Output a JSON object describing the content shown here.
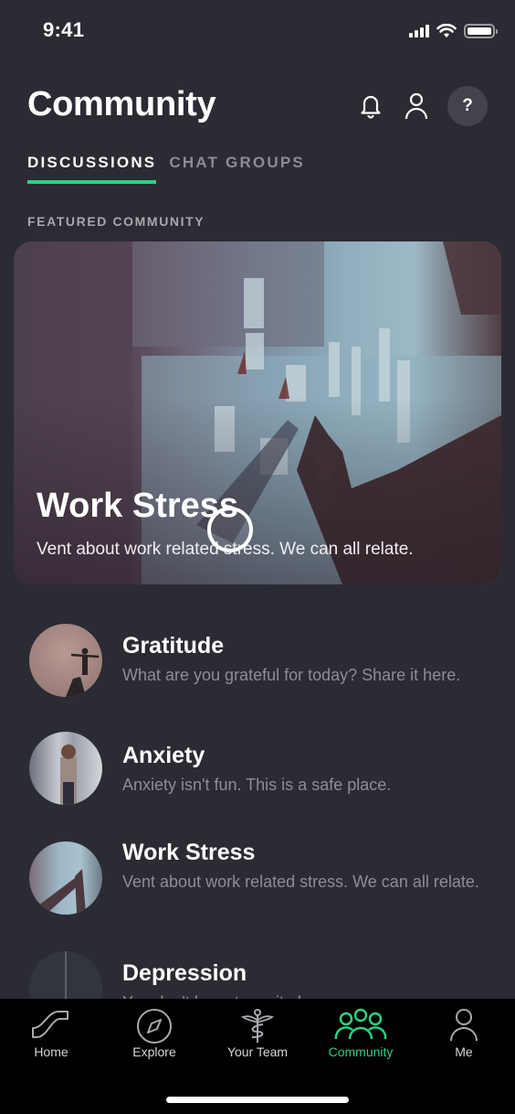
{
  "status_bar": {
    "time": "9:41"
  },
  "header": {
    "title": "Community",
    "help_label": "?"
  },
  "tabs": [
    {
      "label": "DISCUSSIONS",
      "active": true
    },
    {
      "label": "CHAT GROUPS",
      "active": false
    }
  ],
  "featured": {
    "section_label": "FEATURED COMMUNITY",
    "title": "Work Stress",
    "description": "Vent about work related stress. We can all relate."
  },
  "communities": [
    {
      "title": "Gratitude",
      "description": "What are you grateful for today? Share it here."
    },
    {
      "title": "Anxiety",
      "description": "Anxiety isn't fun. This is a safe place."
    },
    {
      "title": "Work Stress",
      "description": "Vent about work related stress. We can all relate."
    },
    {
      "title": "Depression",
      "description": "You don't have to go it alone."
    }
  ],
  "tabbar": {
    "items": [
      {
        "label": "Home",
        "icon": "home-slide-icon",
        "active": false
      },
      {
        "label": "Explore",
        "icon": "compass-icon",
        "active": false
      },
      {
        "label": "Your Team",
        "icon": "caduceus-icon",
        "active": false
      },
      {
        "label": "Community",
        "icon": "community-icon",
        "active": true
      },
      {
        "label": "Me",
        "icon": "person-icon",
        "active": false
      }
    ]
  },
  "colors": {
    "background": "#2b2b33",
    "accent": "#2fcf82",
    "tabbar_background": "#000000",
    "muted_text": "#8d8d95"
  }
}
